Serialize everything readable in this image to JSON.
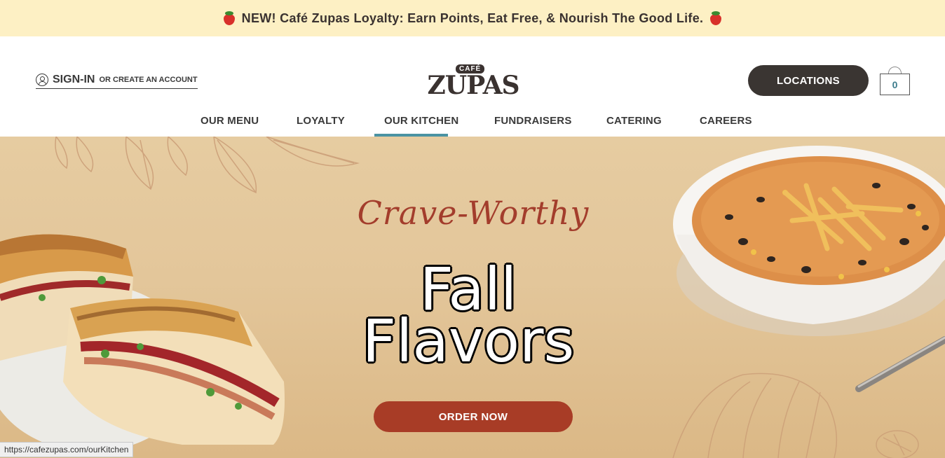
{
  "promo": {
    "text": "NEW! Café Zupas Loyalty: Earn Points, Eat Free, & Nourish The Good Life.",
    "icon_left": "strawberry-icon",
    "icon_right": "strawberry-icon"
  },
  "header": {
    "signin_label": "SIGN-IN",
    "create_account_label": "OR CREATE AN ACCOUNT",
    "logo_top": "CAFÉ",
    "logo_main": "ZUPAS",
    "locations_label": "LOCATIONS",
    "cart_count": "0"
  },
  "nav": {
    "items": [
      {
        "label": "OUR MENU"
      },
      {
        "label": "LOYALTY"
      },
      {
        "label": "OUR KITCHEN",
        "active": true
      },
      {
        "label": "FUNDRAISERS"
      },
      {
        "label": "CATERING"
      },
      {
        "label": "CAREERS"
      }
    ]
  },
  "hero": {
    "script_title": "Crave-Worthy",
    "title_line1": "Fall",
    "title_line2": "Flavors",
    "cta_label": "ORDER NOW"
  },
  "status_bar": {
    "url": "https://cafezupas.com/ourKitchen"
  },
  "colors": {
    "promo_bg": "#fdf0c4",
    "dark_button": "#3a3532",
    "nav_active": "#4b93a3",
    "cta": "#a83c26",
    "script_title": "#a33d2c"
  }
}
